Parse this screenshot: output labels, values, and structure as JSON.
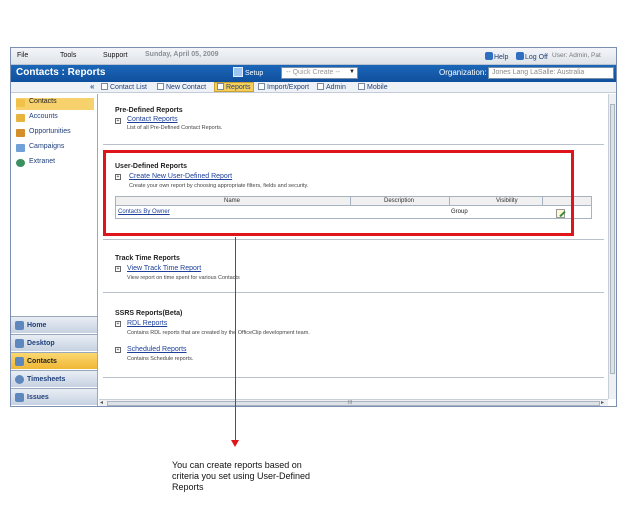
{
  "menu": {
    "file": "File",
    "tools": "Tools",
    "support": "Support"
  },
  "date": "Sunday, April 05, 2009",
  "topright": {
    "help": "Help",
    "logoff": "Log Off",
    "user": "User: Admin, Pat"
  },
  "titlebar": {
    "title": "Contacts : Reports",
    "setup": "Setup",
    "quick_create": "-- Quick Create --",
    "org_label": "Organization:",
    "org_value": "Jones Lang LaSalle: Australia"
  },
  "toolbar": {
    "collapse": "«",
    "contact_list": "Contact List",
    "new_contact": "New Contact",
    "reports": "Reports",
    "import_export": "Import/Export",
    "admin": "Admin",
    "mobile": "Mobile"
  },
  "sidebar": {
    "items": [
      {
        "label": "Contacts",
        "color": "#f0c24a"
      },
      {
        "label": "Accounts",
        "color": "#e8b440"
      },
      {
        "label": "Opportunities",
        "color": "#d58f2a"
      },
      {
        "label": "Campaigns",
        "color": "#6fa0d8"
      },
      {
        "label": "Extranet",
        "color": "#3c8f5e"
      }
    ],
    "nav": [
      "Home",
      "Desktop",
      "Contacts",
      "Timesheets",
      "Issues"
    ]
  },
  "content": {
    "predefined": {
      "title": "Pre-Defined Reports",
      "link": "Contact Reports",
      "desc": "List of all Pre-Defined Contact Reports."
    },
    "userdefined": {
      "title": "User-Defined Reports",
      "link": "Create New User-Defined Report",
      "desc": "Create your own report by choosing appropriate filters, fields and security.",
      "columns": {
        "name": "Name",
        "description": "Description",
        "visibility": "Visibility"
      },
      "row": {
        "name": "Contacts By Owner",
        "description": "",
        "visibility": "Group"
      }
    },
    "tracktime": {
      "title": "Track Time Reports",
      "link": "View Track Time Report",
      "desc": "View report on time spent for various Contacts"
    },
    "ssrs": {
      "title": "SSRS Reports(Beta)",
      "rdl_link": "RDL Reports",
      "rdl_desc": "Contains RDL reports that are created by the OfficeClip development team.",
      "sched_link": "Scheduled Reports",
      "sched_desc": "Contains Schedule reports."
    }
  },
  "scroll": {
    "left": "◂",
    "right": "▸",
    "grip": "III"
  },
  "annotation": {
    "callout": "You can create reports based on criteria you set using User-Defined Reports",
    "color": "#e0151b"
  }
}
